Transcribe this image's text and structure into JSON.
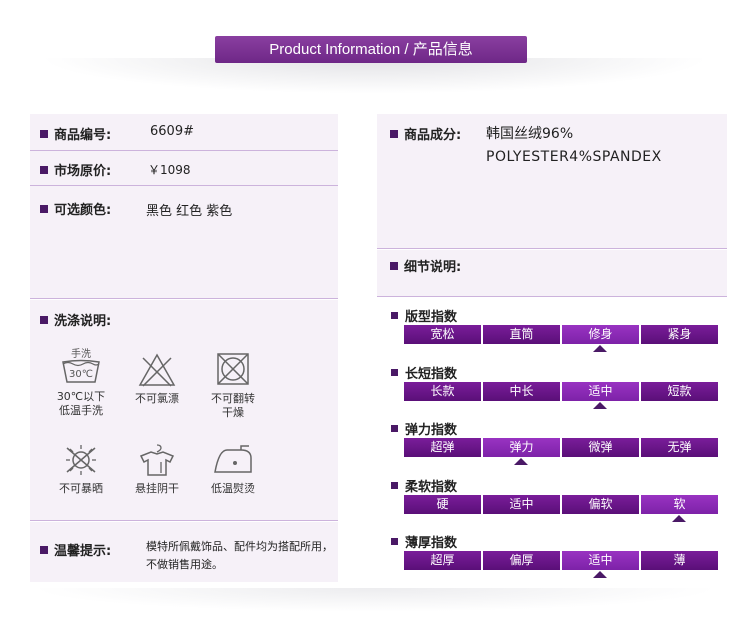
{
  "header": {
    "title": "Product Information / 产品信息"
  },
  "info": {
    "code_label": "商品编号:",
    "code_value": "6609#",
    "price_label": "市场原价:",
    "price_value": "￥1098",
    "colors_label": "可选颜色:",
    "colors_value": "黑色  红色  紫色",
    "material_label": "商品成分:",
    "material_value_1": "韩国丝绒96%",
    "material_value_2": "POLYESTER4%SPANDEX",
    "detail_label": "细节说明:"
  },
  "wash": {
    "label": "洗涤说明:",
    "hand_wash_icon_text": "手洗",
    "hand_wash_temp": "30℃",
    "items": [
      {
        "icon": "hand-wash-icon",
        "line1": "30℃以下",
        "line2": "低温手洗"
      },
      {
        "icon": "no-bleach-icon",
        "line1": "不可氯漂",
        "line2": ""
      },
      {
        "icon": "no-tumble-dry-icon",
        "line1": "不可翻转",
        "line2": "干燥"
      },
      {
        "icon": "no-sun-dry-icon",
        "line1": "不可暴晒",
        "line2": ""
      },
      {
        "icon": "hang-dry-shade-icon",
        "line1": "悬挂阴干",
        "line2": ""
      },
      {
        "icon": "low-iron-icon",
        "line1": "低温熨烫",
        "line2": ""
      }
    ]
  },
  "notice": {
    "label": "温馨提示:",
    "line1": "模特所佩戴饰品、配件均为搭配所用，",
    "line2": "不做销售用途。"
  },
  "indices": [
    {
      "title": "版型指数",
      "options": [
        "宽松",
        "直筒",
        "修身",
        "紧身"
      ],
      "selected": 2
    },
    {
      "title": "长短指数",
      "options": [
        "长款",
        "中长",
        "适中",
        "短款"
      ],
      "selected": 2
    },
    {
      "title": "弹力指数",
      "options": [
        "超弹",
        "弹力",
        "微弹",
        "无弹"
      ],
      "selected": 1
    },
    {
      "title": "柔软指数",
      "options": [
        "硬",
        "适中",
        "偏软",
        "软"
      ],
      "selected": 3
    },
    {
      "title": "薄厚指数",
      "options": [
        "超厚",
        "偏厚",
        "适中",
        "薄"
      ],
      "selected": 2
    }
  ],
  "colors": {
    "accent": "#6e2787",
    "bar": "#5a0f78",
    "panel": "#f6f1f8"
  }
}
